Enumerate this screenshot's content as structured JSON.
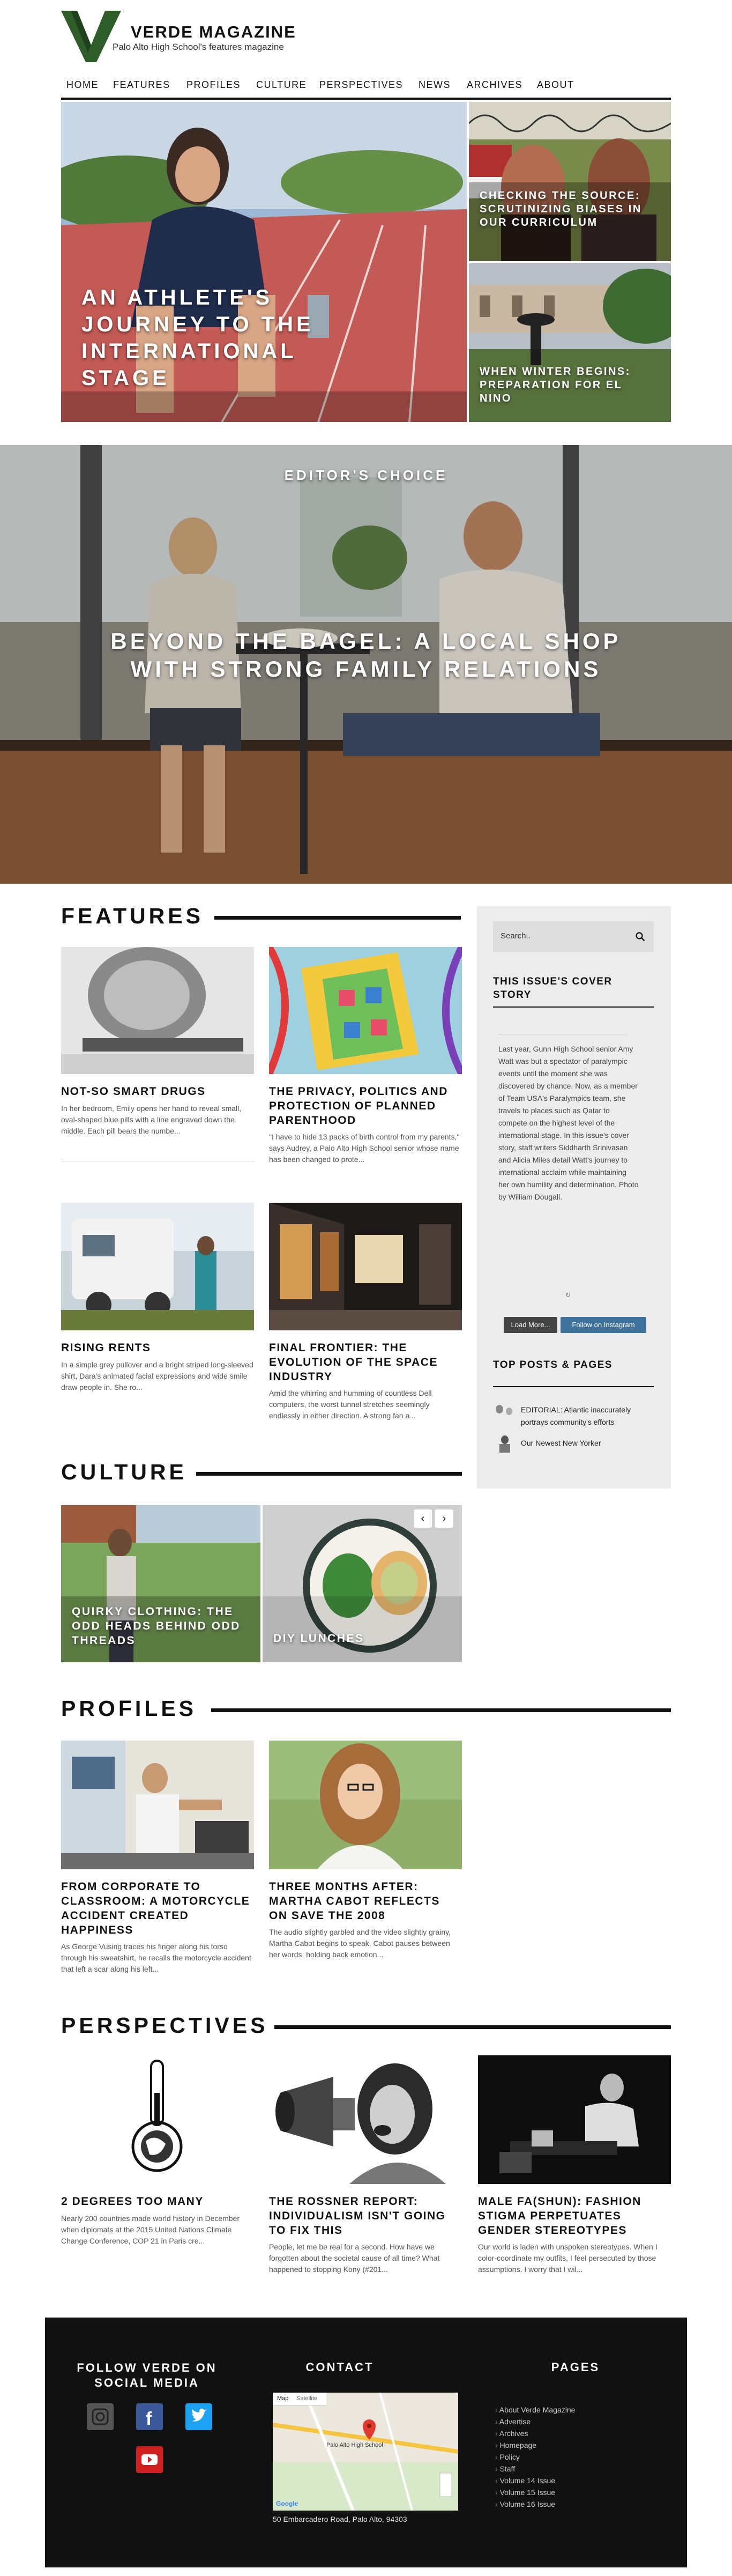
{
  "brand": {
    "title": "VERDE MAGAZINE",
    "subtitle": "Palo Alto High School's features magazine",
    "color": "#2e5d2a"
  },
  "nav": [
    "HOME",
    "FEATURES",
    "PROFILES",
    "CULTURE",
    "PERSPECTIVES",
    "NEWS",
    "ARCHIVES",
    "ABOUT"
  ],
  "hero": {
    "main_title": "AN ATHLETE'S JOURNEY TO THE INTERNATIONAL STAGE",
    "side1_title": "CHECKING THE SOURCE: SCRUTINIZING BIASES IN OUR CURRICULUM",
    "side2_title": "WHEN WINTER BEGINS: PREPARATION FOR EL NINO"
  },
  "editors_choice": {
    "label": "EDITOR'S CHOICE",
    "title": "BEYOND THE BAGEL: A LOCAL SHOP WITH STRONG FAMILY RELATIONS"
  },
  "features": {
    "heading": "FEATURES",
    "cards": [
      {
        "title": "NOT-SO SMART DRUGS",
        "excerpt": "In her bedroom, Emily opens her hand to reveal small, oval-shaped blue pills with a line engraved down the middle. Each pill bears the numbe..."
      },
      {
        "title": "THE PRIVACY, POLITICS AND PROTECTION OF PLANNED PARENTHOOD",
        "excerpt": "\"I have to hide 13 packs of birth control from my parents,\" says Audrey, a Palo Alto High School senior whose name has been changed to prote..."
      },
      {
        "title": "RISING RENTS",
        "excerpt": "In a simple grey pullover and a bright striped long-sleeved shirt, Dara's animated facial expressions and wide smile draw people in. She ro..."
      },
      {
        "title": "FINAL FRONTIER: THE EVOLUTION OF THE SPACE INDUSTRY",
        "excerpt": "Amid the whirring and humming of countless Dell computers, the worst tunnel stretches seemingly endlessly in either direction. A strong fan a..."
      }
    ]
  },
  "sidebar": {
    "search_placeholder": "Search..",
    "cover_heading": "THIS ISSUE'S COVER STORY",
    "cover_text": "Last year, Gunn High School senior Amy Watt was but a spectator of paralympic events until the moment she was discovered by chance. Now, as a member of Team USA's Paralympics team, she travels to places such as Qatar to compete on the highest level of the international stage. In this issue's cover story, staff writers Siddharth Srinivasan and Alicia Miles detail Watt's journey to international acclaim while maintaining her own humility and determination. Photo by William Dougall.",
    "load_more": "Load More...",
    "follow_instagram": "Follow on Instagram",
    "top_heading": "TOP POSTS & PAGES",
    "top_posts": [
      "EDITORIAL: Atlantic inaccurately portrays community's efforts",
      "Our Newest New Yorker"
    ]
  },
  "culture": {
    "heading": "CULTURE",
    "cards": [
      {
        "title": "QUIRKY CLOTHING: THE ODD HEADS BEHIND ODD THREADS"
      },
      {
        "title": "DIY LUNCHES"
      }
    ],
    "prev": "‹",
    "next": "›"
  },
  "profiles": {
    "heading": "PROFILES",
    "cards": [
      {
        "title": "FROM CORPORATE TO CLASSROOM: A MOTORCYCLE ACCIDENT CREATED HAPPINESS",
        "excerpt": "As George Vusing traces his finger along his torso through his sweatshirt, he recalls the motorcycle accident that left a scar along his left..."
      },
      {
        "title": "THREE MONTHS AFTER: MARTHA CABOT REFLECTS ON SAVE THE 2008",
        "excerpt": "The audio slightly garbled and the video slightly grainy, Martha Cabot begins to speak. Cabot pauses between her words, holding back emotion..."
      }
    ]
  },
  "perspectives": {
    "heading": "PERSPECTIVES",
    "cards": [
      {
        "title": "2 DEGREES TOO MANY",
        "excerpt": "Nearly 200 countries made world history in December when diplomats at the 2015 United Nations Climate Change Conference, COP 21 in Paris cre..."
      },
      {
        "title": "THE ROSSNER REPORT: INDIVIDUALISM ISN'T GOING TO FIX THIS",
        "excerpt": "People, let me be real for a second. How have we forgotten about the societal cause of all time? What happened to stopping Kony (#201..."
      },
      {
        "title": "MALE FA(SHUN): FASHION STIGMA PERPETUATES GENDER STEREOTYPES",
        "excerpt": "Our world is laden with unspoken stereotypes. When I color-coordinate my outfits, I feel persecuted by those assumptions. I worry that I wil..."
      }
    ]
  },
  "footer": {
    "social_heading": "FOLLOW VERDE ON SOCIAL MEDIA",
    "contact_heading": "CONTACT",
    "pages_heading": "PAGES",
    "map_tabs": [
      "Map",
      "Satellite"
    ],
    "map_label": "Palo Alto High School",
    "map_credit": "Google",
    "address": "50 Embarcadero Road, Palo Alto, 94303",
    "pages": [
      "About Verde Magazine",
      "Advertise",
      "Archives",
      "Homepage",
      "Policy",
      "Staff",
      "Volume 14 Issue",
      "Volume 15 Issue",
      "Volume 16 Issue"
    ],
    "colors": {
      "instagram": "#555555",
      "facebook": "#3b5998",
      "twitter": "#1da1f2",
      "youtube": "#cd201f"
    }
  }
}
